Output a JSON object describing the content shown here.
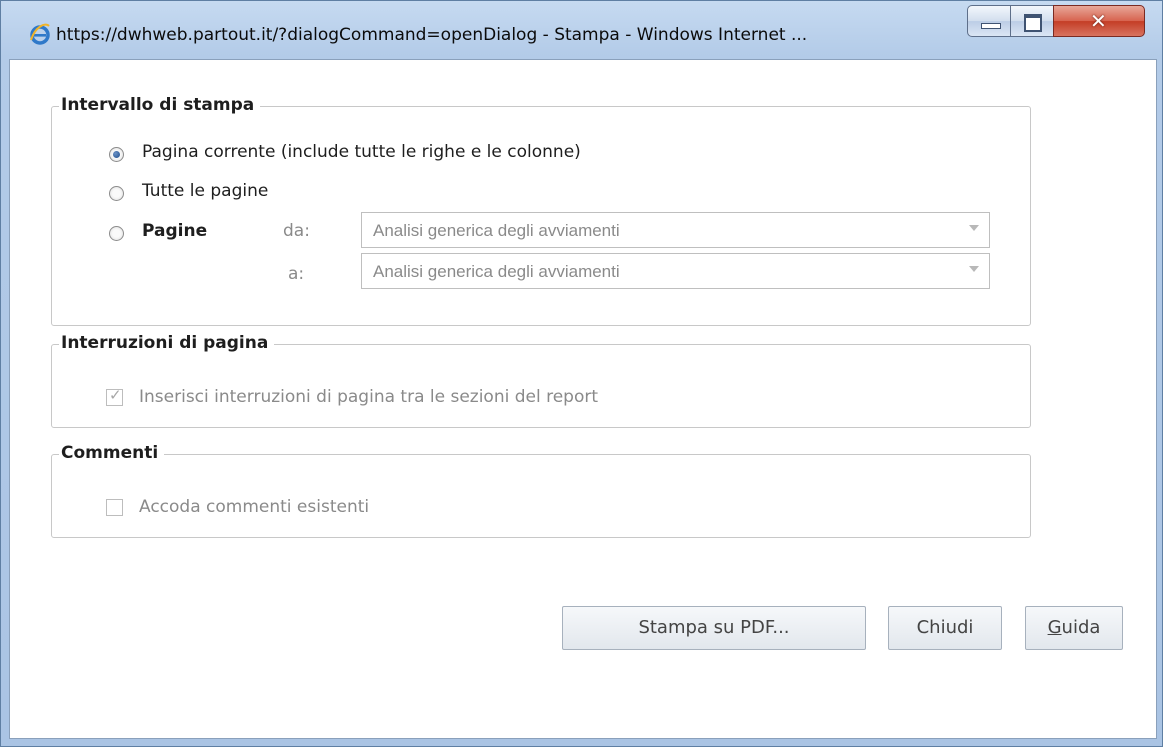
{
  "window": {
    "title": "https://dwhweb.partout.it/?dialogCommand=openDialog - Stampa - Windows Internet ...",
    "icon": "ie-icon"
  },
  "print_range": {
    "legend": "Intervallo di stampa",
    "options": [
      {
        "label": "Pagina corrente (include tutte le righe e le colonne)",
        "selected": true
      },
      {
        "label": "Tutte le pagine",
        "selected": false
      },
      {
        "label": "Pagine",
        "selected": false
      }
    ],
    "from_label": "da:",
    "from_value": "Analisi generica degli avviamenti",
    "to_label": "a:",
    "to_value": "Analisi generica degli avviamenti"
  },
  "page_breaks": {
    "legend": "Interruzioni di pagina",
    "checkbox_label": "Inserisci interruzioni di pagina tra le sezioni del report",
    "checked": true
  },
  "comments": {
    "legend": "Commenti",
    "checkbox_label": "Accoda commenti esistenti",
    "checked": false
  },
  "buttons": {
    "print_pdf": "Stampa su PDF...",
    "close": "Chiudi",
    "help_accel": "G",
    "help_rest": "uida"
  }
}
